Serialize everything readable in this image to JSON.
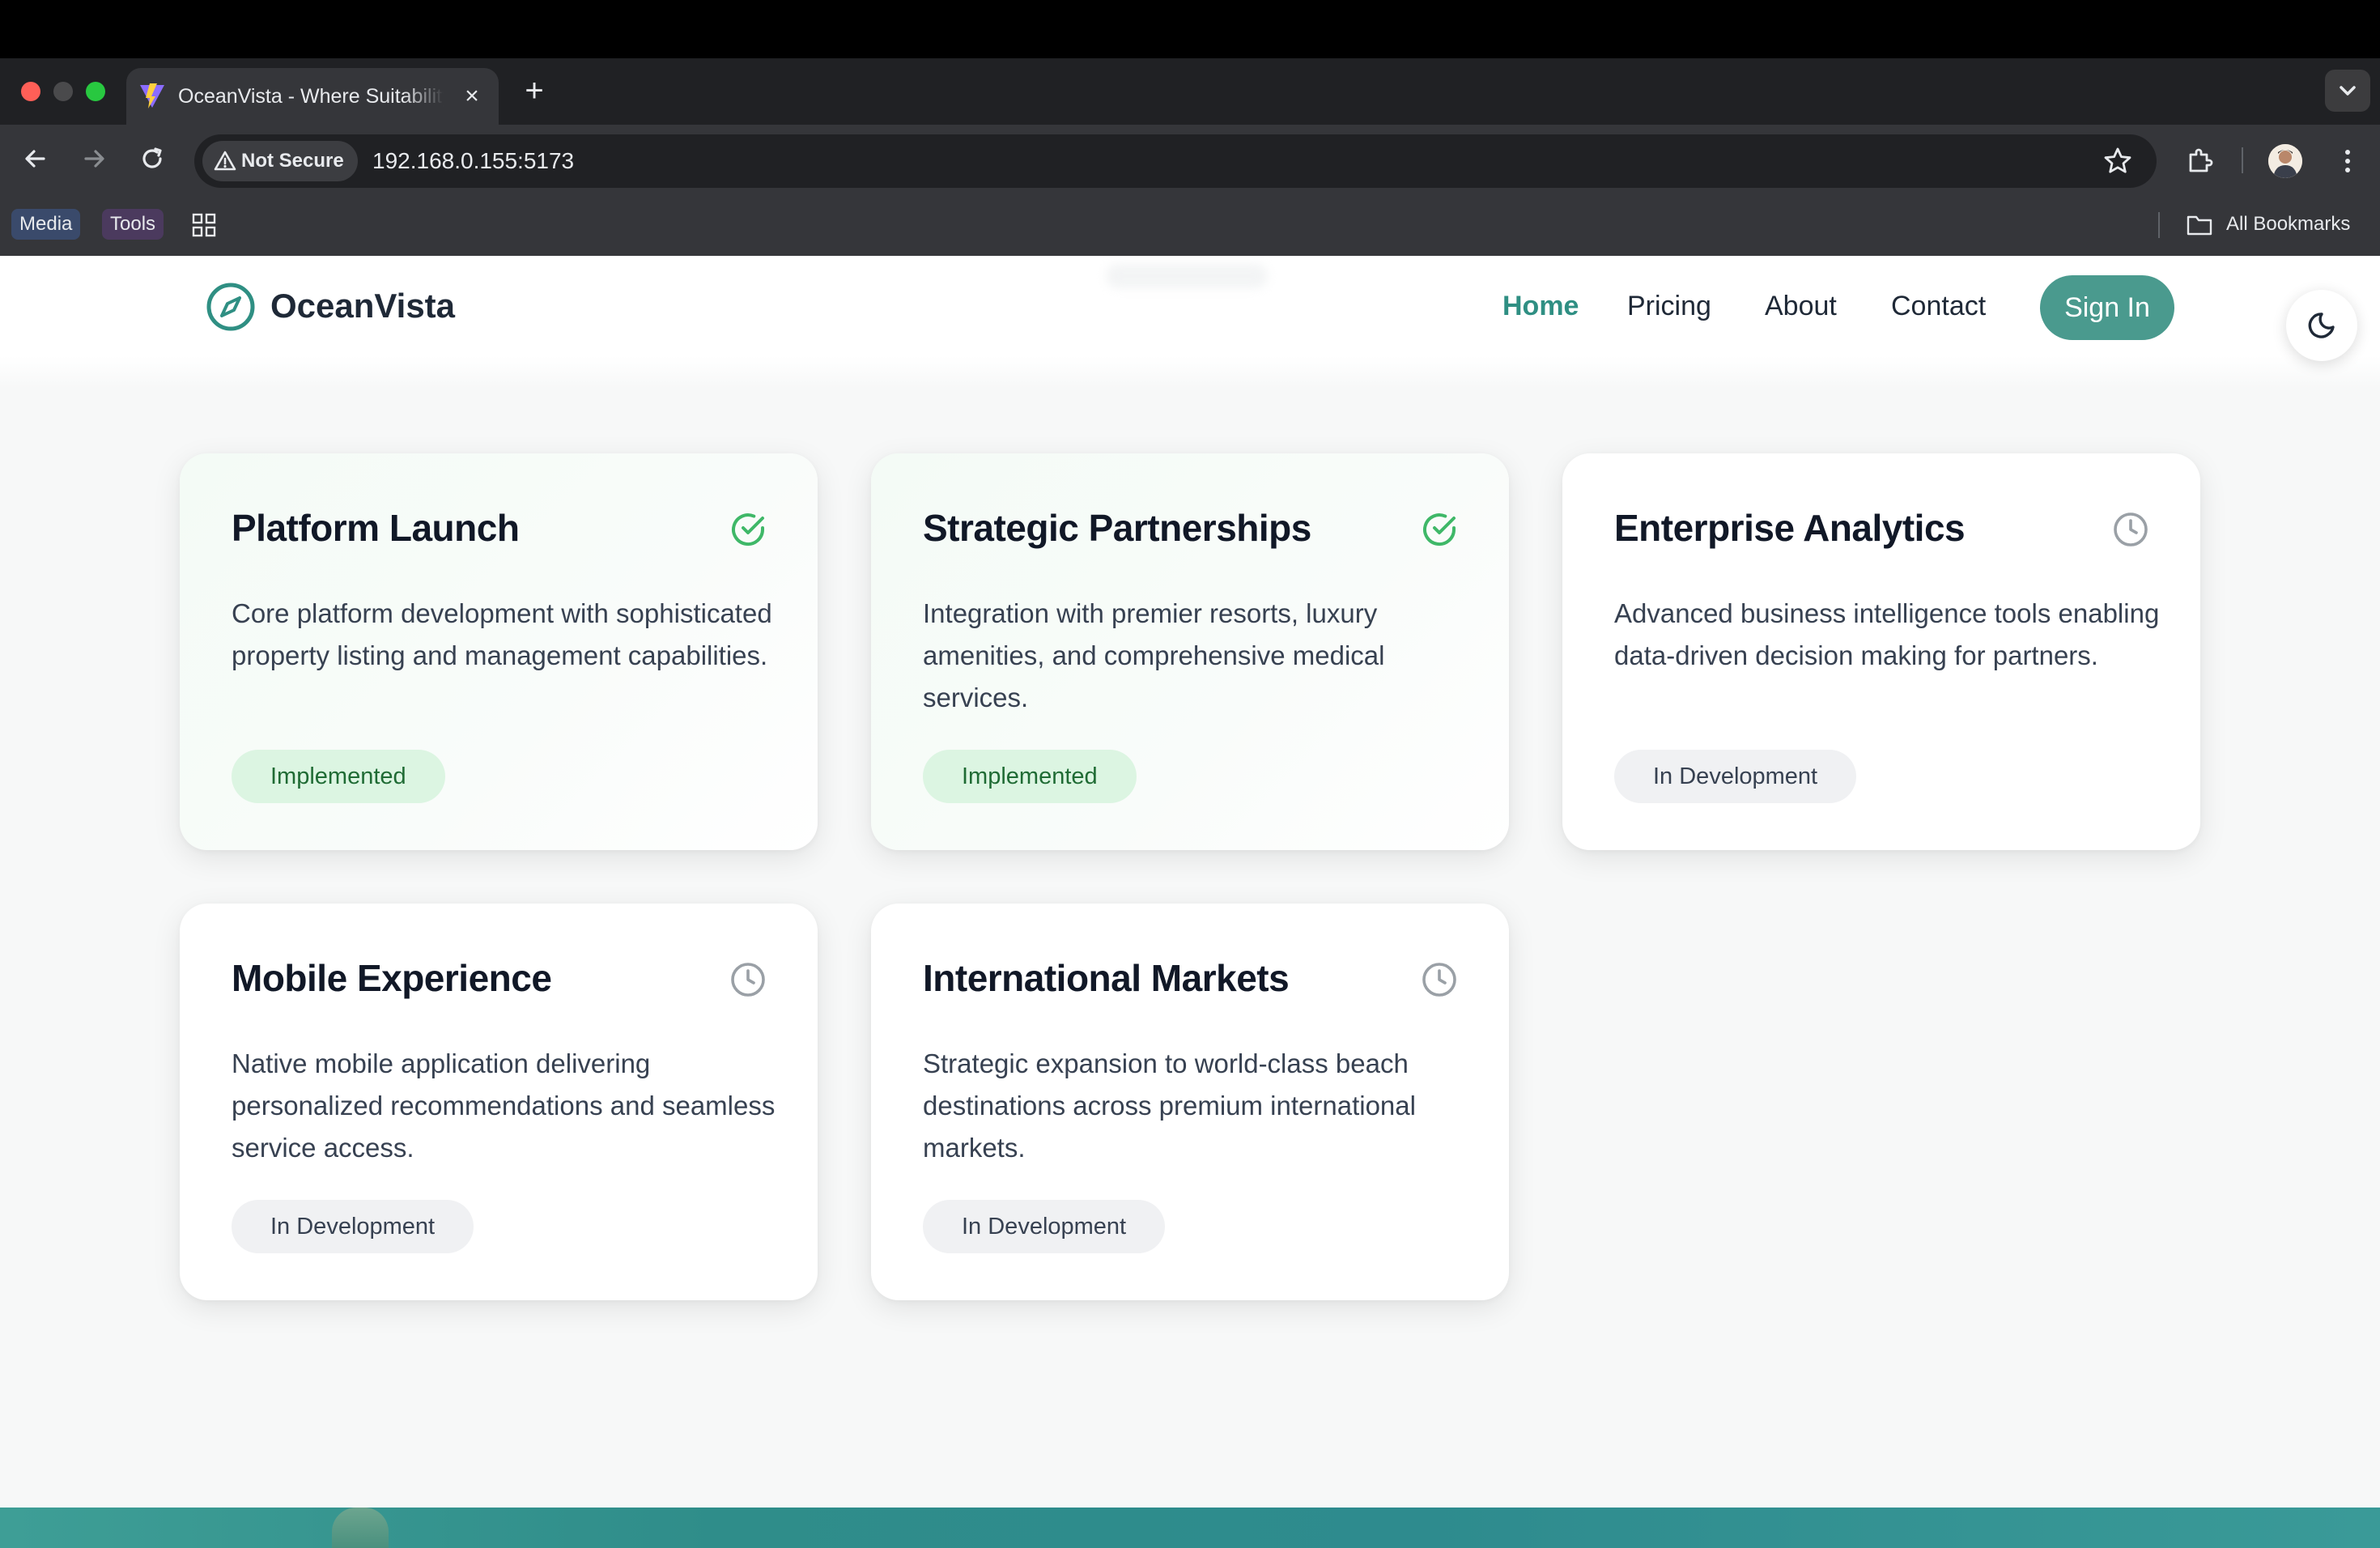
{
  "browser": {
    "tab_title": "OceanVista - Where Suitability",
    "not_secure_label": "Not Secure",
    "url": "192.168.0.155:5173",
    "bookmarks": [
      "Media",
      "Tools"
    ],
    "all_bookmarks_label": "All Bookmarks"
  },
  "site": {
    "brand": "OceanVista",
    "accent": "#2f8f83",
    "nav": [
      {
        "label": "Home",
        "active": true
      },
      {
        "label": "Pricing"
      },
      {
        "label": "About"
      },
      {
        "label": "Contact"
      }
    ],
    "sign_in_label": "Sign In"
  },
  "cards": [
    {
      "title": "Platform Launch",
      "description": "Core platform development with sophisticated property listing and management capabilities.",
      "status": "Implemented",
      "icon": "check-circle-icon"
    },
    {
      "title": "Strategic Partnerships",
      "description": "Integration with premier resorts, luxury amenities, and comprehensive medical services.",
      "status": "Implemented",
      "icon": "check-circle-icon"
    },
    {
      "title": "Enterprise Analytics",
      "description": "Advanced business intelligence tools enabling data-driven decision making for partners.",
      "status": "In Development",
      "icon": "clock-icon"
    },
    {
      "title": "Mobile Experience",
      "description": "Native mobile application delivering personalized recommendations and seamless service access.",
      "status": "In Development",
      "icon": "clock-icon"
    },
    {
      "title": "International Markets",
      "description": "Strategic expansion to world-class beach destinations across premium international markets.",
      "status": "In Development",
      "icon": "clock-icon"
    }
  ]
}
